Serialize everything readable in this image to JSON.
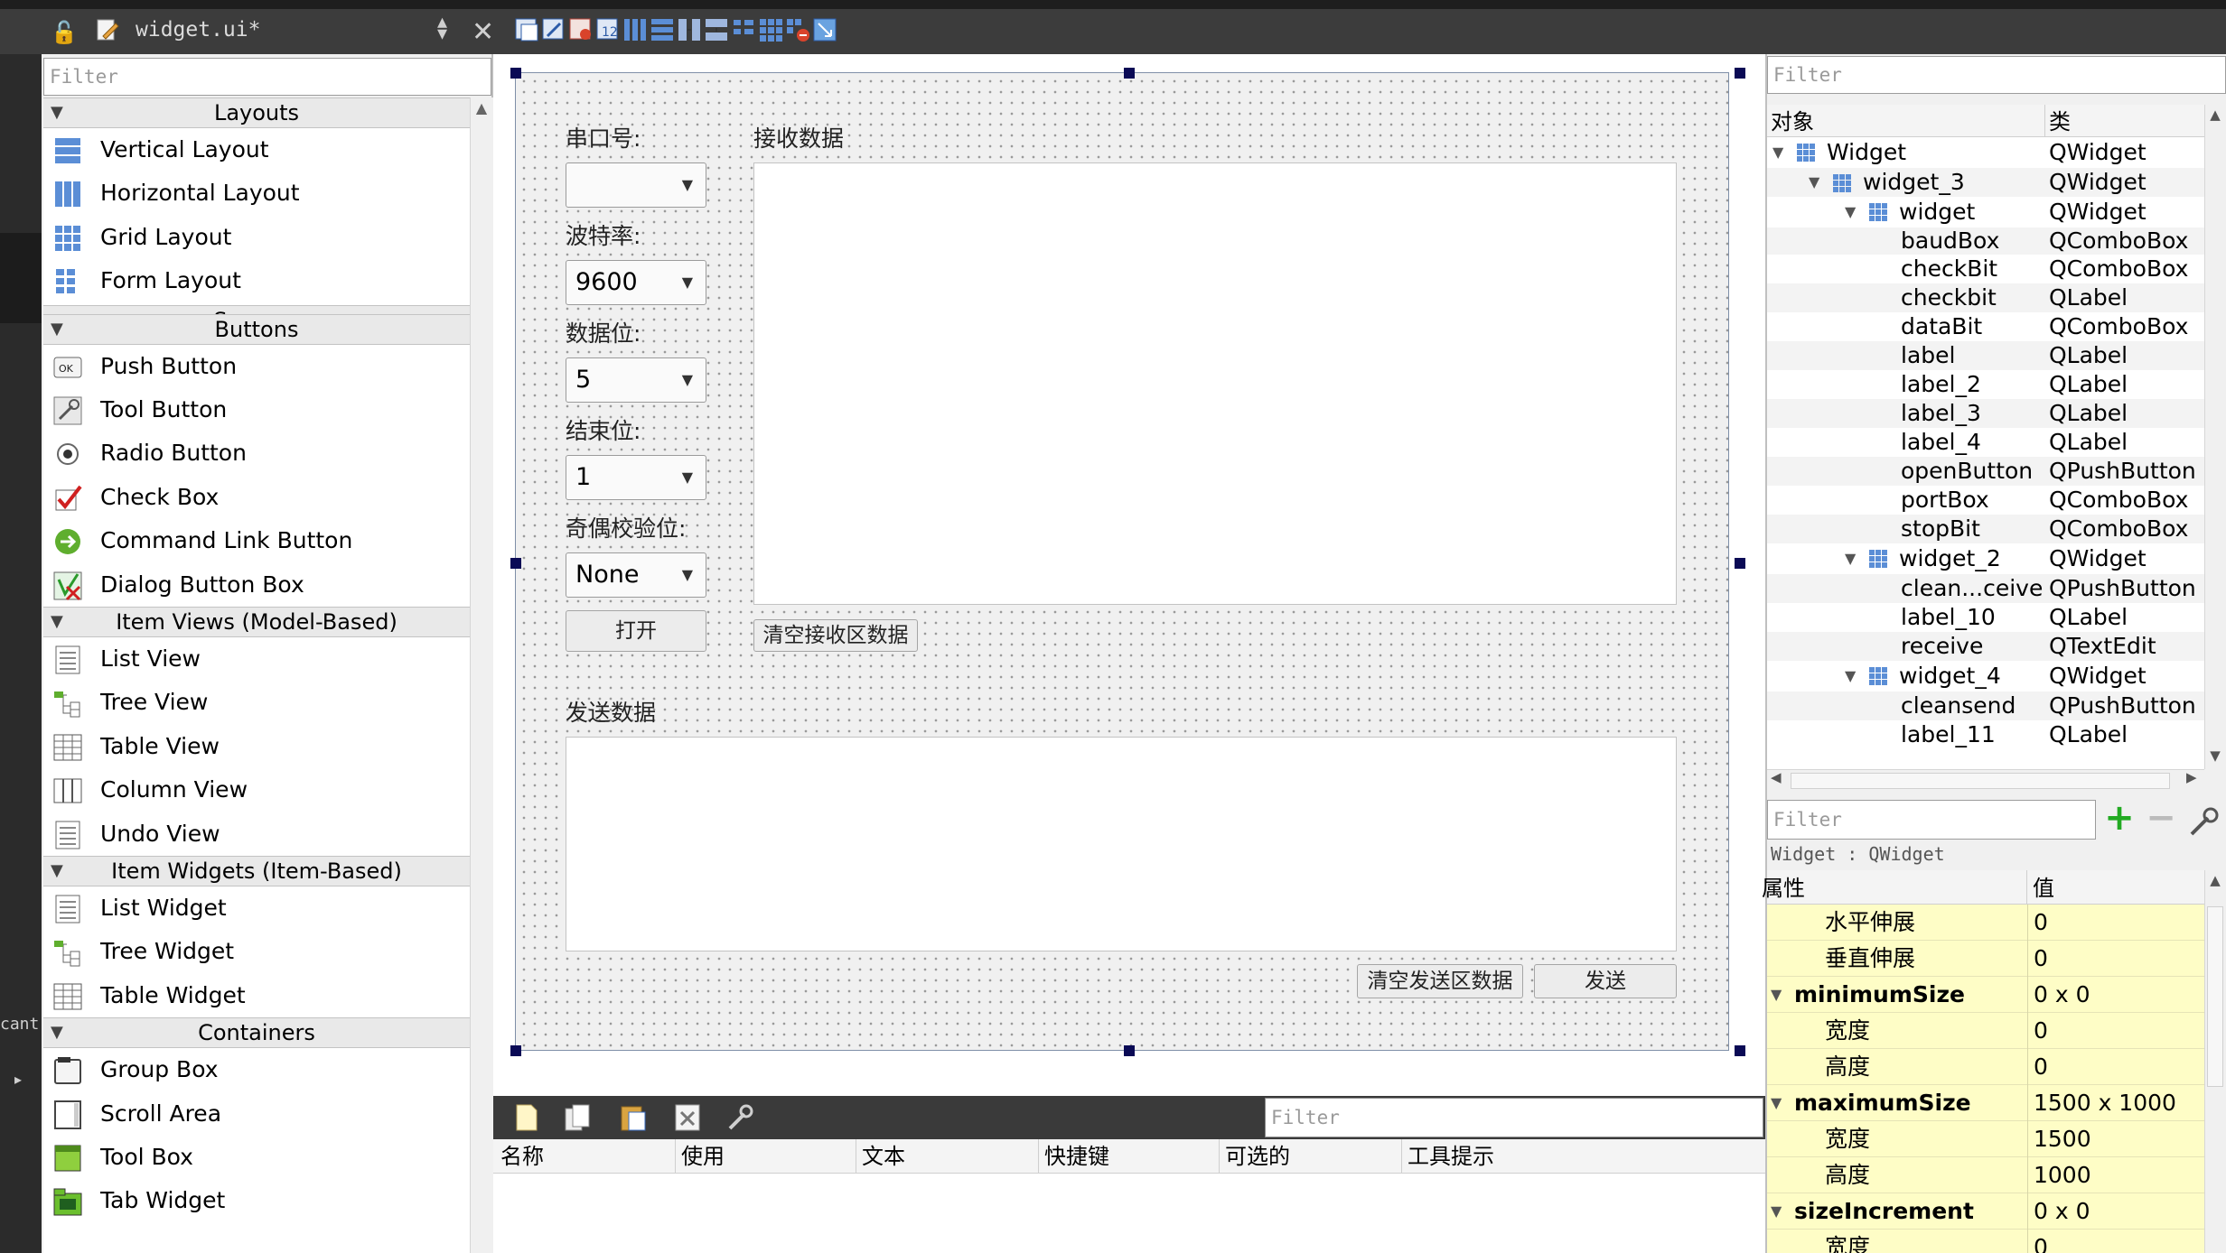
{
  "editor_tab": {
    "file_name": "widget.ui*"
  },
  "mode_strip": {
    "clipped_text": "cant"
  },
  "widget_box": {
    "filter_placeholder": "Filter",
    "categories": [
      {
        "name": "Layouts",
        "items": [
          "Vertical Layout",
          "Horizontal Layout",
          "Grid Layout",
          "Form Layout"
        ]
      },
      {
        "name": "Spacers",
        "items": []
      },
      {
        "name": "Buttons",
        "items": [
          "Push Button",
          "Tool Button",
          "Radio Button",
          "Check Box",
          "Command Link Button",
          "Dialog Button Box"
        ]
      },
      {
        "name": "Item Views (Model-Based)",
        "items": [
          "List View",
          "Tree View",
          "Table View",
          "Column View",
          "Undo View"
        ]
      },
      {
        "name": "Item Widgets (Item-Based)",
        "items": [
          "List Widget",
          "Tree Widget",
          "Table Widget"
        ]
      },
      {
        "name": "Containers",
        "items": [
          "Group Box",
          "Scroll Area",
          "Tool Box",
          "Tab Widget"
        ]
      }
    ]
  },
  "form": {
    "port_label": "串口号:",
    "port_value": "",
    "baud_label": "波特率:",
    "baud_value": "9600",
    "data_label": "数据位:",
    "data_value": "5",
    "stop_label": "结束位:",
    "stop_value": "1",
    "parity_label": "奇偶校验位:",
    "parity_value": "None",
    "open_button": "打开",
    "receive_label": "接收数据",
    "clear_receive_button": "清空接收区数据",
    "send_label": "发送数据",
    "clear_send_button": "清空发送区数据",
    "send_button": "发送"
  },
  "action_editor": {
    "filter_placeholder": "Filter",
    "columns": [
      "名称",
      "使用",
      "文本",
      "快捷键",
      "可选的",
      "工具提示"
    ]
  },
  "object_inspector": {
    "filter_placeholder": "Filter",
    "columns": [
      "对象",
      "类"
    ],
    "rows": [
      {
        "name": "Widget",
        "class": "QWidget"
      },
      {
        "name": "widget_3",
        "class": "QWidget"
      },
      {
        "name": "widget",
        "class": "QWidget"
      },
      {
        "name": "baudBox",
        "class": "QComboBox"
      },
      {
        "name": "checkBit",
        "class": "QComboBox"
      },
      {
        "name": "checkbit",
        "class": "QLabel"
      },
      {
        "name": "dataBit",
        "class": "QComboBox"
      },
      {
        "name": "label",
        "class": "QLabel"
      },
      {
        "name": "label_2",
        "class": "QLabel"
      },
      {
        "name": "label_3",
        "class": "QLabel"
      },
      {
        "name": "label_4",
        "class": "QLabel"
      },
      {
        "name": "openButton",
        "class": "QPushButton"
      },
      {
        "name": "portBox",
        "class": "QComboBox"
      },
      {
        "name": "stopBit",
        "class": "QComboBox"
      },
      {
        "name": "widget_2",
        "class": "QWidget"
      },
      {
        "name": "clean...ceive",
        "class": "QPushButton"
      },
      {
        "name": "label_10",
        "class": "QLabel"
      },
      {
        "name": "receive",
        "class": "QTextEdit"
      },
      {
        "name": "widget_4",
        "class": "QWidget"
      },
      {
        "name": "cleansend",
        "class": "QPushButton"
      },
      {
        "name": "label_11",
        "class": "QLabel"
      }
    ]
  },
  "property_editor": {
    "filter_placeholder": "Filter",
    "class_line": "Widget : QWidget",
    "columns": [
      "属性",
      "值"
    ],
    "rows": [
      {
        "name": "水平伸展",
        "value": "0"
      },
      {
        "name": "垂直伸展",
        "value": "0"
      },
      {
        "name": "minimumSize",
        "value": "0 x 0"
      },
      {
        "name": "宽度",
        "value": "0"
      },
      {
        "name": "高度",
        "value": "0"
      },
      {
        "name": "maximumSize",
        "value": "1500 x 1000"
      },
      {
        "name": "宽度",
        "value": "1500"
      },
      {
        "name": "高度",
        "value": "1000"
      },
      {
        "name": "sizeIncrement",
        "value": "0 x 0"
      },
      {
        "name": "宽度",
        "value": "0"
      }
    ]
  }
}
